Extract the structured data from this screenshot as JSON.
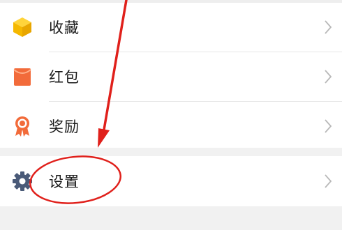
{
  "menu": {
    "items": [
      {
        "label": "收藏",
        "icon": "favorites-cube-icon",
        "color": "#f5b800"
      },
      {
        "label": "红包",
        "icon": "red-envelope-icon",
        "color": "#f26b3a"
      },
      {
        "label": "奖励",
        "icon": "medal-icon",
        "color": "#f26b3a"
      }
    ],
    "settings": {
      "label": "设置",
      "icon": "gear-icon",
      "color": "#4a5a78"
    }
  },
  "annotation": {
    "color": "#e0201b",
    "marks": [
      "red-arrow",
      "red-circle"
    ]
  }
}
